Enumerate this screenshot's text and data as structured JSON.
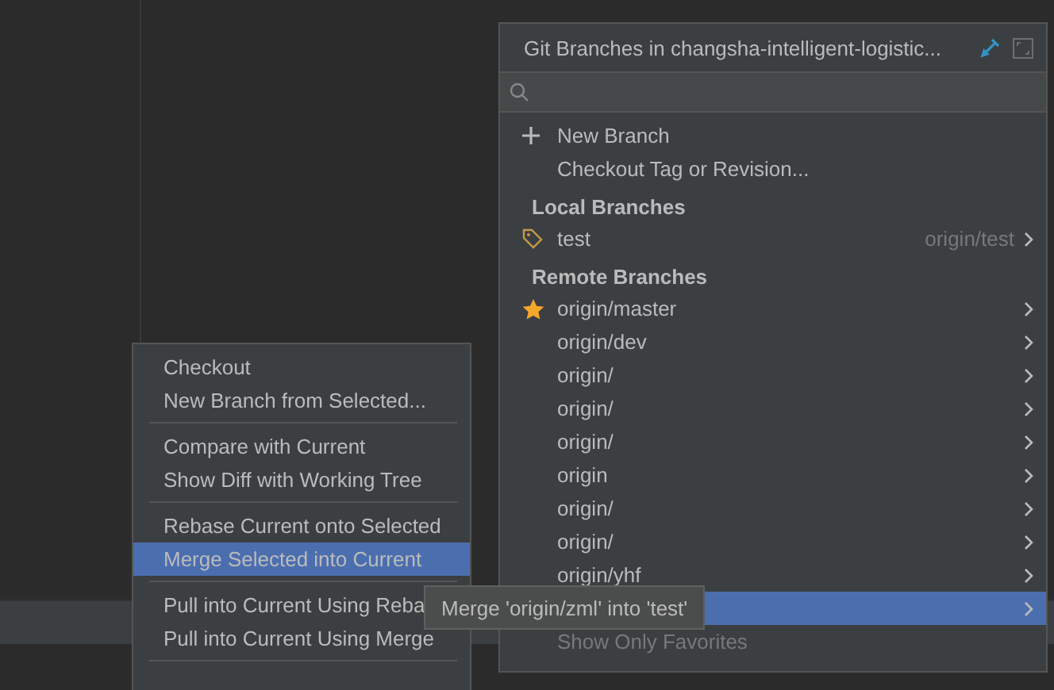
{
  "branches_popup": {
    "title": "Git Branches in changsha-intelligent-logistic...",
    "actions": [
      {
        "label": "New Branch",
        "kind": "add"
      },
      {
        "label": "Checkout Tag or Revision...",
        "kind": "plain"
      }
    ],
    "sections": [
      {
        "heading": "Local Branches",
        "branches": [
          {
            "name": "test",
            "tracking": "origin/test",
            "kind": "current",
            "selected": false
          }
        ]
      },
      {
        "heading": "Remote Branches",
        "branches": [
          {
            "name": "origin/master",
            "kind": "favorite",
            "selected": false
          },
          {
            "name": "origin/dev",
            "kind": "plain",
            "selected": false
          },
          {
            "name": "origin/",
            "kind": "plain",
            "selected": false
          },
          {
            "name": "origin/",
            "kind": "plain",
            "selected": false
          },
          {
            "name": "origin/",
            "kind": "plain",
            "selected": false
          },
          {
            "name": "origin",
            "kind": "plain",
            "selected": false
          },
          {
            "name": "origin/",
            "kind": "plain",
            "selected": false
          },
          {
            "name": "origin/",
            "kind": "plain",
            "selected": false
          },
          {
            "name": "origin/yhf",
            "kind": "plain",
            "selected": false
          },
          {
            "kind": "plain",
            "selected": true
          }
        ]
      }
    ],
    "footer": "Show Only Favorites"
  },
  "context_menu": {
    "groups": [
      [
        {
          "label": "Checkout",
          "selected": false
        },
        {
          "label": "New Branch from Selected...",
          "selected": false
        }
      ],
      [
        {
          "label": "Compare with Current",
          "selected": false
        },
        {
          "label": "Show Diff with Working Tree",
          "selected": false
        }
      ],
      [
        {
          "label": "Rebase Current onto Selected",
          "selected": false
        },
        {
          "label": "Merge Selected into Current",
          "selected": true
        }
      ],
      [
        {
          "label": "Pull into Current Using Reba",
          "selected": false
        },
        {
          "label": "Pull into Current Using Merge",
          "selected": false
        }
      ]
    ]
  },
  "tooltip": "Merge 'origin/zml' into 'test'"
}
